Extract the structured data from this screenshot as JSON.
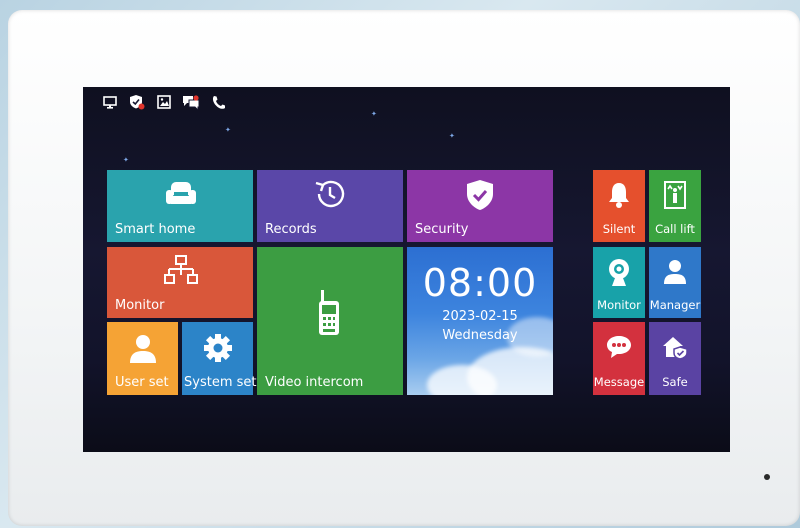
{
  "status_icons": [
    "monitor-status-icon",
    "security-status-icon",
    "photo-status-icon",
    "message-status-icon",
    "call-status-icon"
  ],
  "tiles": {
    "smart_home": {
      "label": "Smart home",
      "color": "#2aa3ad",
      "icon": "sofa-icon"
    },
    "records": {
      "label": "Records",
      "color": "#5a47a8",
      "icon": "history-icon"
    },
    "security": {
      "label": "Security",
      "color": "#8c36a6",
      "icon": "shield-check-icon"
    },
    "monitor_main": {
      "label": "Monitor",
      "color": "#d9573a",
      "icon": "network-icon"
    },
    "video_intercom": {
      "label": "Video intercom",
      "color": "#3c9d42",
      "icon": "walkie-talkie-icon"
    },
    "user_set": {
      "label": "User set",
      "color": "#f5a335",
      "icon": "user-icon"
    },
    "system_set": {
      "label": "System set",
      "color": "#2c84c8",
      "icon": "gear-icon"
    }
  },
  "clock": {
    "time": "08:00",
    "date": "2023-02-15",
    "day": "Wednesday"
  },
  "side_tiles": {
    "silent": {
      "label": "Silent",
      "color": "#e5502d",
      "icon": "bell-icon"
    },
    "call_lift": {
      "label": "Call lift",
      "color": "#3aa340",
      "icon": "elevator-icon"
    },
    "monitor_side": {
      "label": "Monitor",
      "color": "#18a2a9",
      "icon": "camera-icon"
    },
    "manager": {
      "label": "Manager",
      "color": "#2f78c9",
      "icon": "person-icon"
    },
    "message": {
      "label": "Message",
      "color": "#d3313e",
      "icon": "chat-icon"
    },
    "safe": {
      "label": "Safe",
      "color": "#5a43a3",
      "icon": "home-shield-icon"
    }
  }
}
